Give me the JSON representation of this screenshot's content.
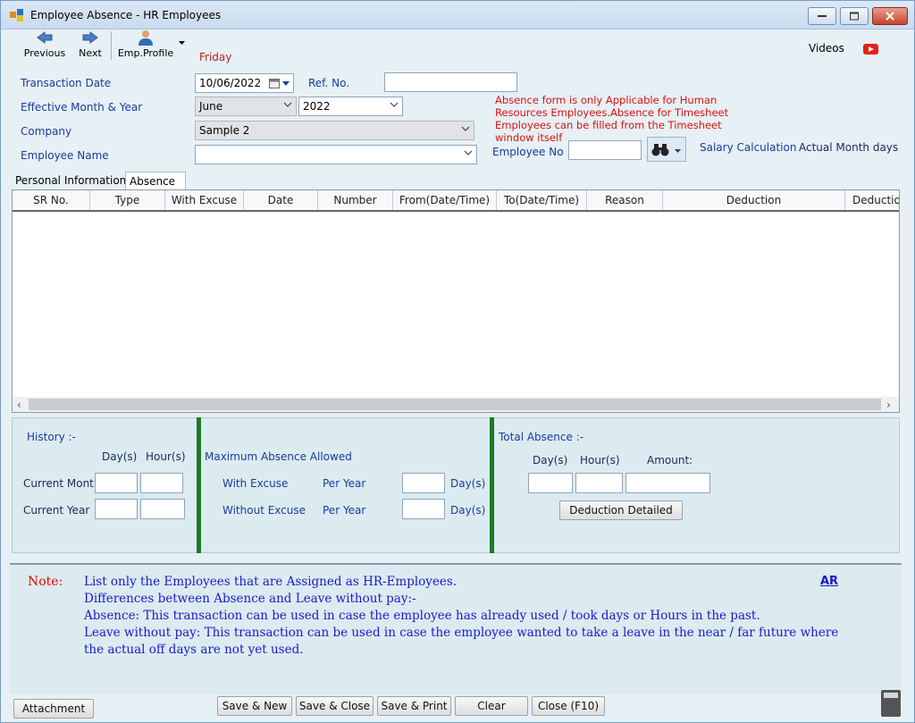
{
  "window": {
    "title": "Employee Absence - HR Employees"
  },
  "toolbar": {
    "previous": "Previous",
    "next": "Next",
    "emp_profile": "Emp.Profile"
  },
  "day_label": "Friday",
  "videos_label": "Videos",
  "form": {
    "transaction_date_label": "Transaction Date",
    "transaction_date": "10/06/2022",
    "ref_no_label": "Ref. No.",
    "ref_no": "",
    "effective_label": "Effective Month & Year",
    "month": "June",
    "year": "2022",
    "company_label": "Company",
    "company": "Sample 2",
    "employee_name_label": "Employee Name",
    "employee_name": "",
    "employee_no_label": "Employee No",
    "employee_no": "",
    "salary_calc_label": "Salary Calculation",
    "actual_month_days_label": "Actual Month days",
    "warning": "Absence form is only Applicable for Human Resources Employees.Absence for Timesheet Employees can be filled from the Timesheet window itself"
  },
  "tabs": [
    "Personal Information",
    "Absence"
  ],
  "grid": {
    "columns": [
      "SR No.",
      "Type",
      "With Excuse",
      "Date",
      "Number",
      "From(Date/Time)",
      "To(Date/Time)",
      "Reason",
      "Deduction",
      "Deductio"
    ],
    "rows": []
  },
  "history": {
    "title": "History :-",
    "days_label": "Day(s)",
    "hours_label": "Hour(s)",
    "current_month_label": "Current Month",
    "current_year_label": "Current Year"
  },
  "max_absence": {
    "title": "Maximum Absence Allowed",
    "with_excuse_label": "With Excuse",
    "without_excuse_label": "Without Excuse",
    "per_year_label": "Per Year",
    "days_label": "Day(s)"
  },
  "total_absence": {
    "title": "Total Absence :-",
    "days_label": "Day(s)",
    "hours_label": "Hour(s)",
    "amount_label": "Amount:",
    "deduction_detailed": "Deduction Detailed"
  },
  "note": {
    "label": "Note:",
    "lines": [
      "List only the Employees that are Assigned as HR-Employees.",
      "Differences between Absence and Leave without pay:-",
      "Absence: This transaction can be used in case the employee has already used / took days or Hours in the past.",
      "Leave without pay: This transaction can be used in case the employee wanted to take a leave in the near / far future where",
      "the actual off days are not yet used."
    ],
    "ar_link": "AR"
  },
  "footer": {
    "attachment": "Attachment",
    "save_new": "Save & New",
    "save_close": "Save & Close",
    "save_print": "Save & Print",
    "clear": "Clear",
    "close": "Close (F10)"
  },
  "colors": {
    "accent_blue": "#1a3b9c",
    "warning_red": "#d11111",
    "divider_green": "#1f7a24",
    "note_blue": "#1a1acc"
  }
}
